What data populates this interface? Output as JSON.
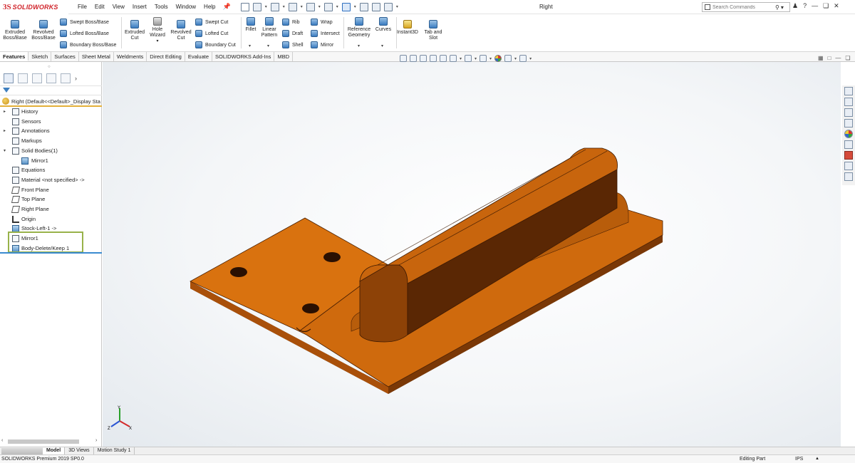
{
  "app": {
    "logo_prefix": "3S",
    "logo_text": "SOLIDWORKS",
    "window_title": "Right"
  },
  "menu": [
    "File",
    "Edit",
    "View",
    "Insert",
    "Tools",
    "Window",
    "Help"
  ],
  "search": {
    "placeholder": "Search Commands"
  },
  "commands": {
    "extruded_boss": "Extruded Boss/Base",
    "revolved_boss": "Revolved Boss/Base",
    "swept_boss": "Swept Boss/Base",
    "lofted_boss": "Lofted Boss/Base",
    "boundary_boss": "Boundary Boss/Base",
    "extruded_cut": "Extruded Cut",
    "hole_wizard": "Hole Wizard",
    "revolved_cut": "Revolved Cut",
    "swept_cut": "Swept Cut",
    "lofted_cut": "Lofted Cut",
    "boundary_cut": "Boundary Cut",
    "fillet": "Fillet",
    "linear_pattern": "Linear Pattern",
    "rib": "Rib",
    "draft": "Draft",
    "shell": "Shell",
    "wrap": "Wrap",
    "intersect": "Intersect",
    "mirror": "Mirror",
    "reference_geometry": "Reference Geometry",
    "curves": "Curves",
    "instant3d": "Instant3D",
    "tab_and_slot": "Tab and Slot"
  },
  "tabs": [
    "Features",
    "Sketch",
    "Surfaces",
    "Sheet Metal",
    "Weldments",
    "Direct Editing",
    "Evaluate",
    "SOLIDWORKS Add-Ins",
    "MBD"
  ],
  "feature_tree": {
    "root": "Right  (Default<<Default>_Display Sta",
    "nodes": [
      {
        "label": "History"
      },
      {
        "label": "Sensors"
      },
      {
        "label": "Annotations"
      },
      {
        "label": "Markups"
      },
      {
        "label": "Solid Bodies(1)"
      },
      {
        "label": "Mirror1"
      },
      {
        "label": "Equations"
      },
      {
        "label": "Material <not specified> ->"
      },
      {
        "label": "Front Plane"
      },
      {
        "label": "Top Plane"
      },
      {
        "label": "Right Plane"
      },
      {
        "label": "Origin"
      },
      {
        "label": "Stock-Left-1 ->"
      },
      {
        "label": "Mirror1"
      },
      {
        "label": "Body-Delete/Keep 1"
      }
    ]
  },
  "bottom_tabs": [
    "Model",
    "3D Views",
    "Motion Study 1"
  ],
  "status": {
    "product": "SOLIDWORKS Premium 2019 SP0.0",
    "mode": "Editing Part",
    "units": "IPS"
  },
  "colors": {
    "part_face": "#c25e0c",
    "part_top": "#d9720f",
    "part_dark": "#5a2704",
    "selection_box": "#98b24a",
    "panel_accent": "#e3b03a"
  },
  "triad": {
    "x": "X",
    "y": "Y",
    "z": "Z"
  }
}
